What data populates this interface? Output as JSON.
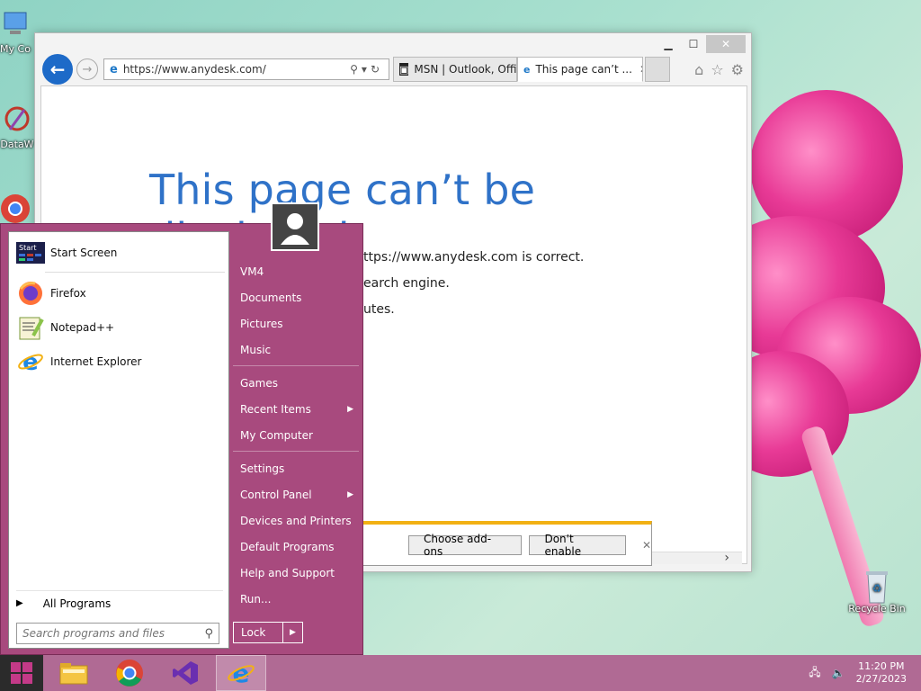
{
  "desktop": {
    "icons": [
      {
        "label": "My Co"
      },
      {
        "label": "DataW"
      },
      {
        "label": "Recycle Bin"
      }
    ]
  },
  "browser": {
    "address": "https://www.anydesk.com/",
    "tabs": [
      {
        "label": "MSN | Outlook, Offi..."
      },
      {
        "label": "This page can’t ..."
      }
    ],
    "error": {
      "title": "This page can’t be displayed",
      "lines": [
        "ttps://www.anydesk.com is correct.",
        "earch engine.",
        "utes."
      ]
    },
    "notification": {
      "choose_label": "Choose add-ons",
      "dont_label": "Don't enable"
    }
  },
  "start_menu": {
    "pinned": [
      {
        "label": "Start Screen",
        "icon": "start-screen-icon"
      },
      {
        "label": "Firefox",
        "icon": "firefox-icon"
      },
      {
        "label": "Notepad++",
        "icon": "notepadpp-icon"
      },
      {
        "label": "Internet Explorer",
        "icon": "ie-icon"
      }
    ],
    "all_programs": "All Programs",
    "search_placeholder": "Search programs and files",
    "right_items": [
      {
        "label": "VM4"
      },
      {
        "label": "Documents"
      },
      {
        "label": "Pictures"
      },
      {
        "label": "Music"
      },
      {
        "label": "Games"
      },
      {
        "label": "Recent Items"
      },
      {
        "label": "My Computer"
      },
      {
        "label": "Settings"
      },
      {
        "label": "Control Panel"
      },
      {
        "label": "Devices and Printers"
      },
      {
        "label": "Default Programs"
      },
      {
        "label": "Help and Support"
      },
      {
        "label": "Run..."
      }
    ],
    "lock_label": "Lock"
  },
  "taskbar": {
    "time": "11:20 PM",
    "date": "2/27/2023"
  },
  "colors": {
    "start_menu": "#a84a7e",
    "taskbar": "#b06a94",
    "ie_blue": "#1d6ac8",
    "error_title": "#2f72c8",
    "notif_bar": "#f2b114"
  }
}
